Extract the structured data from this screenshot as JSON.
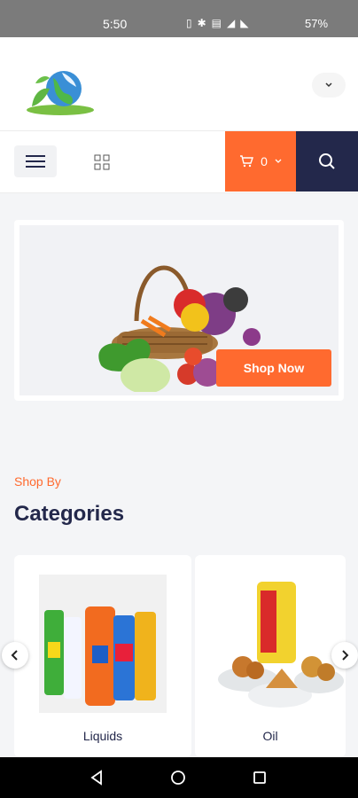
{
  "status_bar": {
    "time": "5:50",
    "battery": "57%",
    "icons": [
      "vibrate-icon",
      "bluetooth-icon",
      "volte-icon",
      "signal-icon",
      "wifi-icon"
    ]
  },
  "header": {
    "logo": "leaf-globe-logo",
    "dropdown_icon": "chevron-down-icon"
  },
  "nav": {
    "menu_icon": "hamburger-icon",
    "grid_icon": "grid-icon",
    "cart_count": "0",
    "cart_icon": "cart-icon",
    "search_icon": "search-icon"
  },
  "hero": {
    "button_label": "Shop Now",
    "image": "vegetable-basket"
  },
  "categories": {
    "kicker": "Shop By",
    "title": "Categories",
    "items": [
      {
        "label": "Liquids",
        "image": "detergent-bottles"
      },
      {
        "label": "Oil",
        "image": "fortune-oil-snacks"
      }
    ]
  },
  "colors": {
    "accent": "#ff6a2f",
    "navy": "#23284b",
    "page_bg": "#f4f5f7"
  }
}
